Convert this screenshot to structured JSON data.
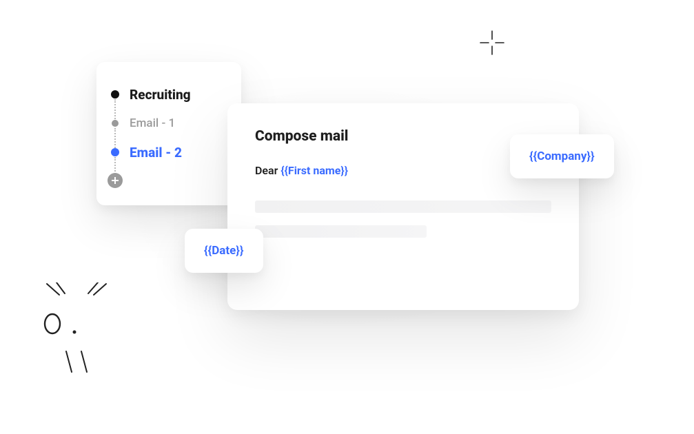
{
  "sidebar": {
    "title": "Recruiting",
    "items": [
      {
        "label": "Email - 1"
      },
      {
        "label": "Email - 2"
      }
    ]
  },
  "compose": {
    "title": "Compose mail",
    "greeting_prefix": "Dear ",
    "greeting_token": "{{First name}}"
  },
  "variables": {
    "company": "{{Company}}",
    "date": "{{Date}}"
  },
  "colors": {
    "accent": "#3a6bff",
    "muted": "#9a9a9a",
    "text": "#1f1f1f"
  }
}
